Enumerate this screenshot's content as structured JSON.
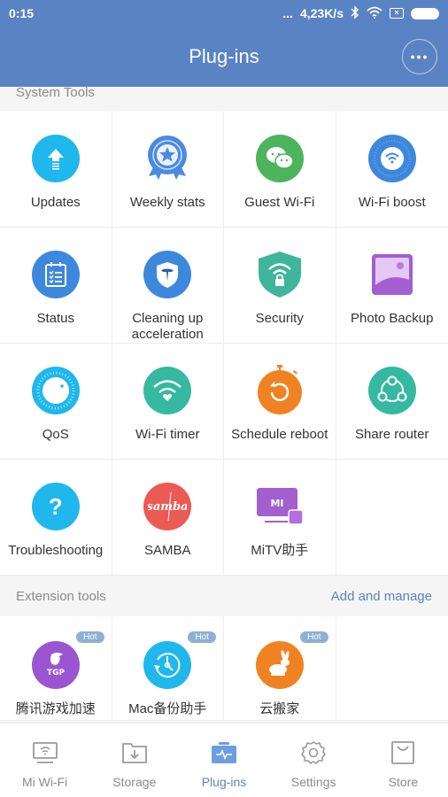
{
  "status_bar": {
    "time": "0:15",
    "dots": "...",
    "speed": "4,23K/s",
    "icons": [
      "bluetooth-icon",
      "wifi-icon",
      "sim-icon",
      "battery-icon"
    ]
  },
  "header": {
    "title": "Plug-ins",
    "more_label": "•••"
  },
  "system_tools": {
    "title": "System Tools",
    "items": [
      {
        "label": "Updates",
        "icon": "update-arrow-icon",
        "color": "#1fb7ec"
      },
      {
        "label": "Weekly stats",
        "icon": "medal-star-icon",
        "color": "#4a8ae0"
      },
      {
        "label": "Guest Wi-Fi",
        "icon": "chat-bubbles-icon",
        "color": "#4cb45c"
      },
      {
        "label": "Wi-Fi boost",
        "icon": "wifi-boost-icon",
        "color": "#3d88dc"
      },
      {
        "label": "Status",
        "icon": "clipboard-checklist-icon",
        "color": "#3d88dc"
      },
      {
        "label": "Cleaning up acceleration",
        "icon": "shield-broom-icon",
        "color": "#3d88dc"
      },
      {
        "label": "Security",
        "icon": "shield-wifi-lock-icon",
        "color": "#3fb59a"
      },
      {
        "label": "Photo Backup",
        "icon": "photo-icon",
        "color": "#a35ed0"
      },
      {
        "label": "QoS",
        "icon": "qos-dial-icon",
        "color": "#1fb7ec"
      },
      {
        "label": "Wi-Fi timer",
        "icon": "wifi-heart-icon",
        "color": "#35b9a0"
      },
      {
        "label": "Schedule reboot",
        "icon": "stopwatch-reboot-icon",
        "color": "#f08222"
      },
      {
        "label": "Share router",
        "icon": "share-nodes-icon",
        "color": "#35b9a0"
      },
      {
        "label": "Troubleshooting",
        "icon": "question-icon",
        "color": "#1fb7ec"
      },
      {
        "label": "SAMBA",
        "icon": "samba-icon",
        "color": "#ec5a55"
      },
      {
        "label": "MiTV助手",
        "icon": "mitv-icon",
        "color": "#a35ed0"
      }
    ]
  },
  "extension_tools": {
    "title": "Extension tools",
    "action": "Add and manage",
    "items": [
      {
        "label": "腾讯游戏加速",
        "icon": "tgp-icon",
        "color": "#9a55d0",
        "badge": "Hot"
      },
      {
        "label": "Mac备份助手",
        "icon": "clock-backup-icon",
        "color": "#1fb7ec",
        "badge": "Hot"
      },
      {
        "label": "云搬家",
        "icon": "rabbit-icon",
        "color": "#f08222",
        "badge": "Hot"
      }
    ]
  },
  "tabbar": {
    "items": [
      {
        "label": "Mi Wi-Fi",
        "icon": "monitor-wifi-icon",
        "active": false
      },
      {
        "label": "Storage",
        "icon": "folder-download-icon",
        "active": false
      },
      {
        "label": "Plug-ins",
        "icon": "toolbox-pulse-icon",
        "active": true
      },
      {
        "label": "Settings",
        "icon": "gear-icon",
        "active": false
      },
      {
        "label": "Store",
        "icon": "shopping-bag-icon",
        "active": false
      }
    ]
  }
}
